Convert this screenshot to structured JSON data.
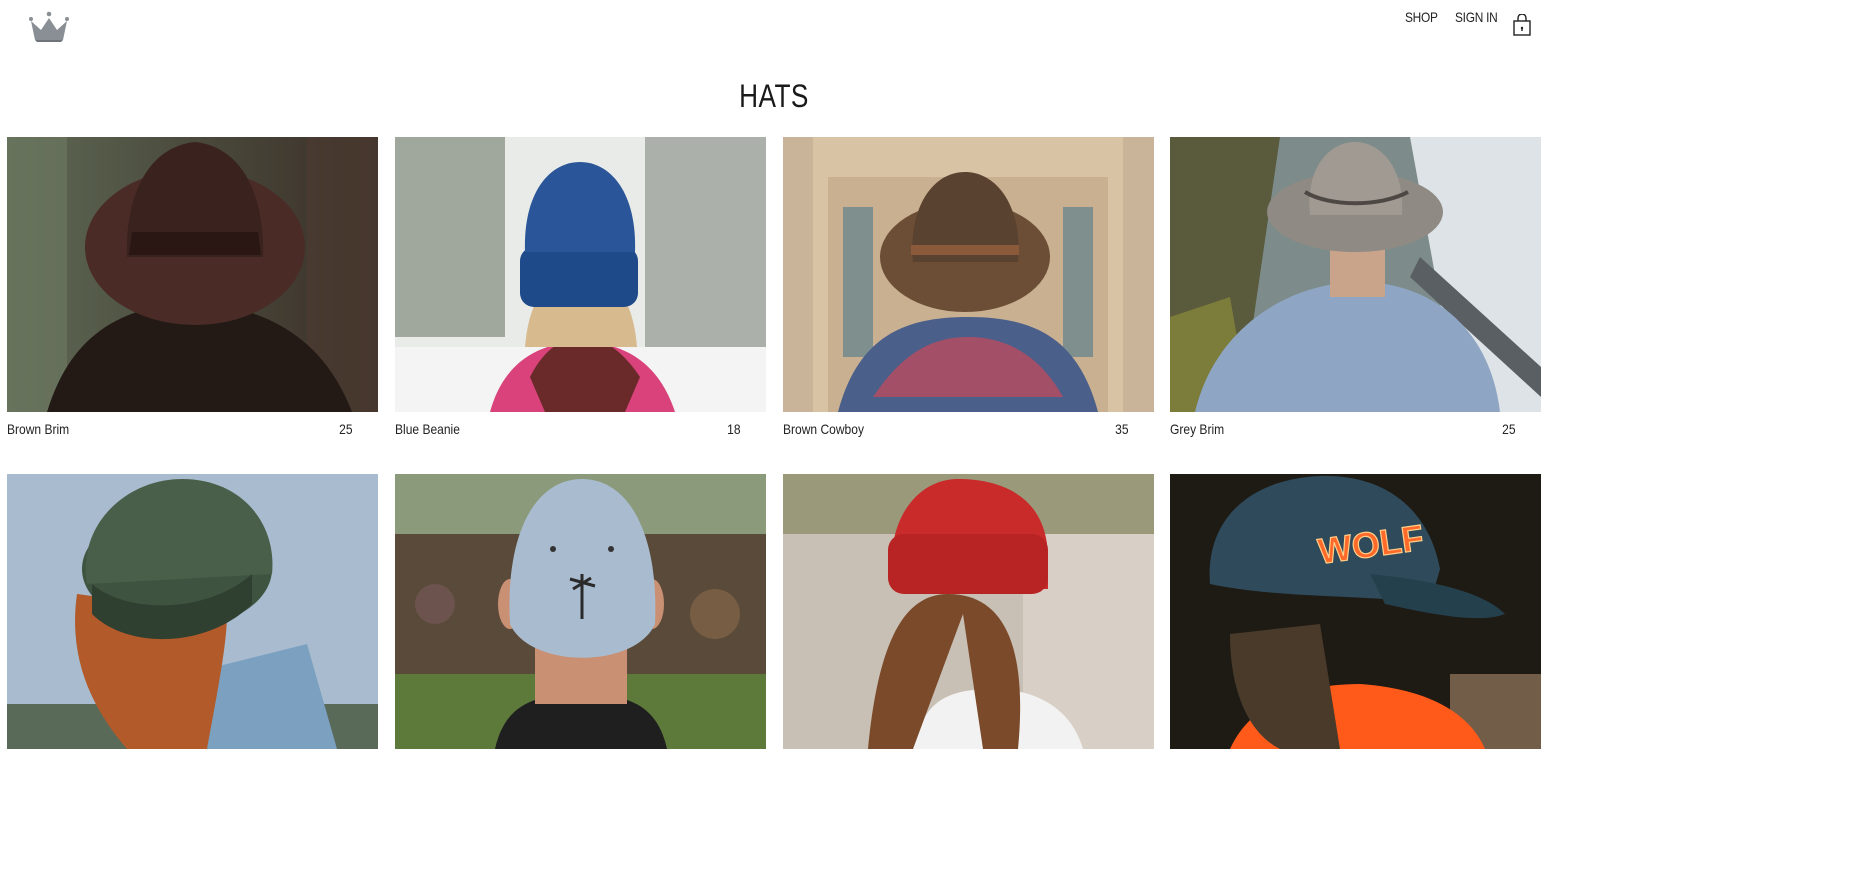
{
  "header": {
    "logo_icon": "crown-icon",
    "nav": {
      "shop": "SHOP",
      "sign_in": "SIGN IN"
    },
    "cart_icon": "shopping-bag-icon"
  },
  "page": {
    "title": "HATS"
  },
  "products": [
    {
      "name": "Brown Brim",
      "price": "25",
      "image": "woman-brown-fedora-forest"
    },
    {
      "name": "Blue Beanie",
      "price": "18",
      "image": "woman-blue-beanie-snow"
    },
    {
      "name": "Brown Cowboy",
      "price": "35",
      "image": "person-brown-cowboy-hat-scarf"
    },
    {
      "name": "Grey Brim",
      "price": "25",
      "image": "man-grey-brim-hat-coast"
    },
    {
      "name": "",
      "price": "",
      "image": "woman-green-knit-beanie"
    },
    {
      "name": "",
      "price": "",
      "image": "man-denim-cap-palm-crowd"
    },
    {
      "name": "",
      "price": "",
      "image": "woman-red-beanie"
    },
    {
      "name": "",
      "price": "",
      "image": "person-wolf-cap"
    }
  ],
  "colors": {
    "background": "#ffffff",
    "text": "#222222"
  }
}
